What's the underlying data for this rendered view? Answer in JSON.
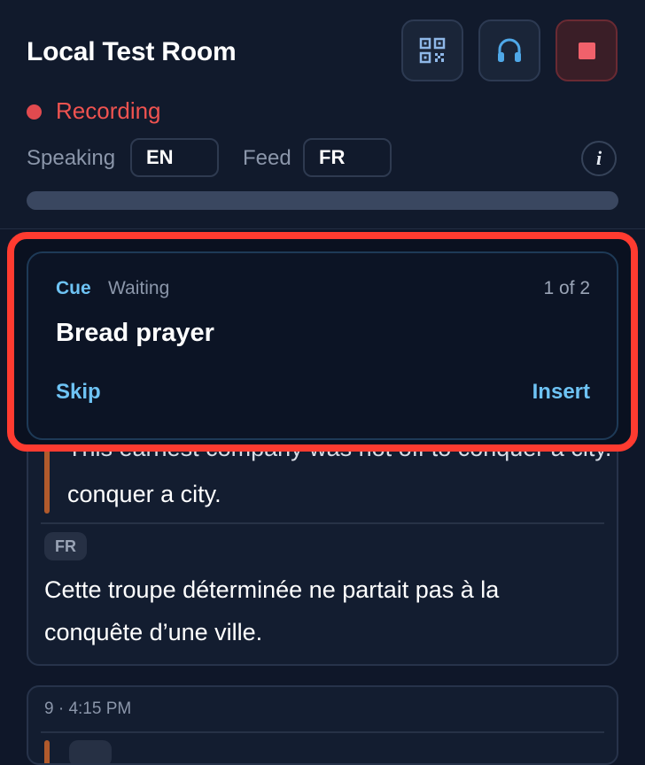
{
  "header": {
    "title": "Local Test Room",
    "buttons": {
      "qr": "qr-code-icon",
      "audio": "headphones-icon",
      "stop": "stop-icon"
    },
    "status": {
      "label": "Recording",
      "color": "#ef5350"
    },
    "speaking": {
      "label": "Speaking",
      "value": "EN"
    },
    "feed": {
      "label": "Feed",
      "value": "FR"
    },
    "info_icon": "i",
    "progress": 1
  },
  "cue": {
    "label": "Cue",
    "status": "Waiting",
    "count": "1 of 2",
    "title": "Bread prayer",
    "skip_label": "Skip",
    "insert_label": "Insert"
  },
  "transcript": [
    {
      "source_tail": "This earnest company was not off to conquer a city.",
      "source_visible": "conquer a city.",
      "target_lang": "FR",
      "target_text": "Cette troupe déterminée ne partait pas à la conquête d’une ville."
    },
    {
      "timestamp": "9 · 4:15 PM"
    }
  ],
  "colors": {
    "accent": "#6ec3f4",
    "highlight": "#ff3b30",
    "recording": "#e14a4f"
  }
}
